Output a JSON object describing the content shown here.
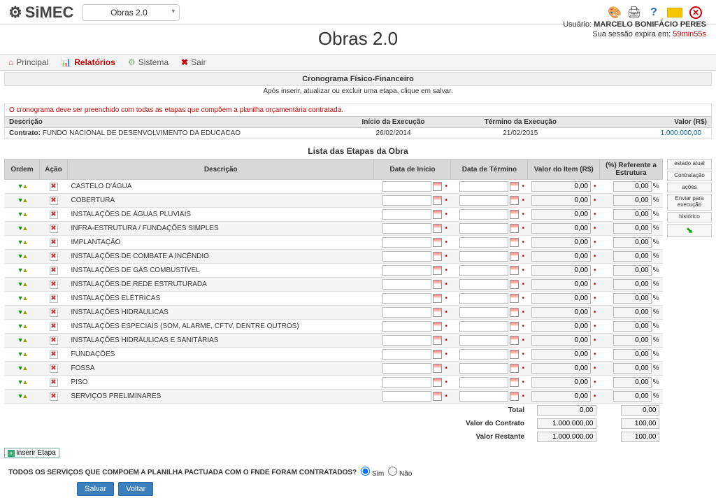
{
  "header": {
    "logo_text": "SiMEC",
    "module": "Obras 2.0",
    "app_title": "Obras 2.0",
    "user_label": "Usuário:",
    "user_name": "MARCELO BONIFÁCIO PERES",
    "session_prefix": "Sua sessão expira em:",
    "session_time": "59min55s"
  },
  "nav": {
    "principal": "Principal",
    "relatorios": "Relatórios",
    "sistema": "Sistema",
    "sair": "Sair"
  },
  "cronograma": {
    "title": "Cronograma Físico-Financeiro",
    "subtitle": "Após inserir, atualizar ou excluir uma etapa, clique em salvar.",
    "warning": "O cronograma deve ser preenchido com todas as etapas que compõem a planilha orçamentária contratada.",
    "hdr_desc": "Descrição",
    "hdr_inicio": "Início da Execução",
    "hdr_termino": "Término da Execução",
    "hdr_valor": "Valor (R$)",
    "contrato_label": "Contrato:",
    "contrato_nome": "FUNDO NACIONAL DE DESENVOLVIMENTO DA EDUCACAO",
    "inicio_exec": "26/02/2014",
    "termino_exec": "21/02/2015",
    "valor_contrato_top": "1.000.000,00"
  },
  "lista": {
    "title": "Lista das Etapas da Obra",
    "th_ordem": "Ordem",
    "th_acao": "Ação",
    "th_desc": "Descrição",
    "th_dt_inicio": "Data de Início",
    "th_dt_termino": "Data de Término",
    "th_valor": "Valor do Item (R$)",
    "th_pct": "(%) Referente a Estrutura",
    "etapas": [
      "CASTELO D'ÁGUA",
      "COBERTURA",
      "INSTALAÇÕES DE ÁGUAS PLUVIAIS",
      "INFRA-ESTRUTURA / FUNDAÇÕES SIMPLES",
      "IMPLANTAÇÃO",
      "INSTALAÇÕES DE COMBATE A INCÊNDIO",
      "INSTALAÇÕES DE GÁS COMBUSTÍVEL",
      "INSTALAÇÕES DE REDE ESTRUTURADA",
      "INSTALAÇÕES ELÉTRICAS",
      "INSTALAÇÕES HIDRÁULICAS",
      "INSTALAÇÕES ESPECIAIS (SOM, ALARME, CFTV, DENTRE OUTROS)",
      "INSTALAÇÕES HIDRÁULICAS E SANITÁRIAS",
      "FUNDAÇÕES",
      "FOSSA",
      "PISO",
      "SERVIÇOS PRELIMINARES"
    ],
    "zero": "0,00",
    "total_label": "Total",
    "total_valor": "0,00",
    "total_pct": "0,00",
    "valor_contrato_label": "Valor do Contrato",
    "valor_contrato": "1.000.000,00",
    "valor_contrato_pct": "100,00",
    "valor_restante_label": "Valor Restante",
    "valor_restante": "1.000.000,00",
    "valor_restante_pct": "100,00",
    "insert_btn": "Inserir Etapa"
  },
  "sidebar": {
    "estado": "estado atual",
    "contratacao": "Contratação",
    "acoes": "ações",
    "enviar": "Enviar para execução",
    "historico": "histórico"
  },
  "footer": {
    "question": "TODOS OS SERVIÇOS QUE COMPOEM A PLANILHA PACTUADA COM O FNDE FORAM CONTRATADOS?",
    "sim": "Sim",
    "nao": "Não",
    "salvar": "Salvar",
    "voltar": "Voltar"
  }
}
